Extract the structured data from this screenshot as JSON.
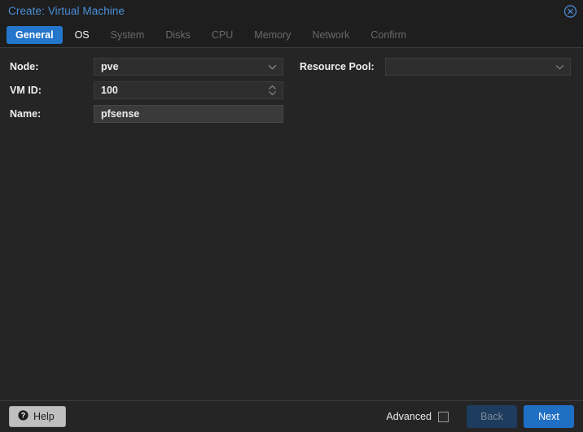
{
  "window": {
    "title": "Create: Virtual Machine",
    "close_icon": "close-circle-icon"
  },
  "tabs": [
    {
      "label": "General",
      "state": "active"
    },
    {
      "label": "OS",
      "state": "enabled"
    },
    {
      "label": "System",
      "state": "disabled"
    },
    {
      "label": "Disks",
      "state": "disabled"
    },
    {
      "label": "CPU",
      "state": "disabled"
    },
    {
      "label": "Memory",
      "state": "disabled"
    },
    {
      "label": "Network",
      "state": "disabled"
    },
    {
      "label": "Confirm",
      "state": "disabled"
    }
  ],
  "form": {
    "left": {
      "node": {
        "label": "Node:",
        "value": "pve",
        "placeholder": "",
        "control": "combobox",
        "icon": "chevron-down-icon"
      },
      "vmid": {
        "label": "VM ID:",
        "value": "100",
        "placeholder": "",
        "control": "spinner",
        "icon": "spinner-arrows-icon"
      },
      "name": {
        "label": "Name:",
        "value": "pfsense",
        "placeholder": "",
        "control": "textfield"
      }
    },
    "right": {
      "resource_pool": {
        "label": "Resource Pool:",
        "value": "",
        "placeholder": "",
        "control": "combobox",
        "icon": "chevron-down-icon"
      }
    }
  },
  "footer": {
    "help_label": "Help",
    "help_icon": "question-circle-icon",
    "advanced_label": "Advanced",
    "advanced_checked": false,
    "back_label": "Back",
    "back_enabled": false,
    "next_label": "Next",
    "next_enabled": true
  },
  "colors": {
    "accent": "#2476cc",
    "title": "#4a90d9",
    "primary_button": "#1f6fc4",
    "disabled_button": "#1d3c5e",
    "window_bg": "#252525",
    "header_bg": "#1e1e1e",
    "field_bg": "#2e2e2e",
    "field_focus_bg": "#3a3a3a"
  }
}
